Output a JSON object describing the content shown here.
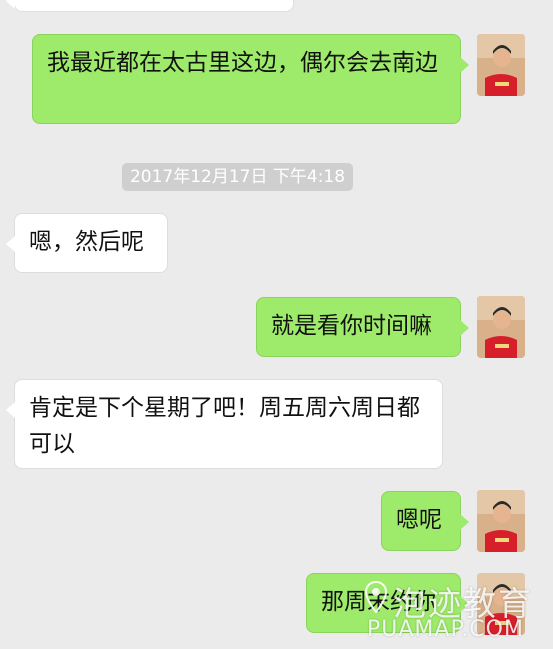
{
  "chat": {
    "messages": [
      {
        "id": "m1",
        "side": "right",
        "text": "我最近都在太古里这边，偶尔会去南边"
      },
      {
        "id": "m2",
        "side": "left",
        "text": "嗯，然后呢"
      },
      {
        "id": "m3",
        "side": "right",
        "text": "就是看你时间嘛"
      },
      {
        "id": "m4",
        "side": "left",
        "text": "肯定是下个星期了吧！周五周六周日都可以"
      },
      {
        "id": "m5",
        "side": "right",
        "text": "嗯呢"
      },
      {
        "id": "m6",
        "side": "right",
        "text": "那周末约你"
      }
    ],
    "timestamp": "2017年12月17日 下午4:18"
  },
  "colors": {
    "background": "#ebebeb",
    "my_bubble": "#9eea6a",
    "their_bubble": "#ffffff",
    "timestamp_pill": "#cfcfcf"
  },
  "watermark": {
    "cn": "泡迹教育",
    "en": "PUAMAP.COM",
    "icon": "map-pin-icon"
  }
}
